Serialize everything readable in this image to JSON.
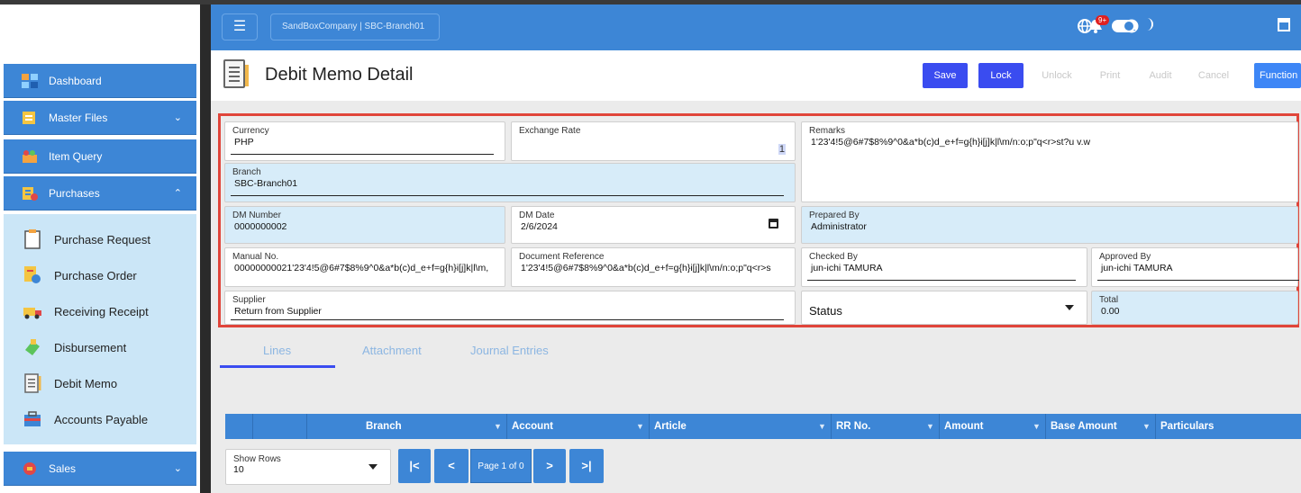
{
  "topbar": {
    "menu_icon": "menu-icon",
    "company": "SandBoxCompany | SBC-Branch01",
    "notification_badge": "9+"
  },
  "sidebar": {
    "items": [
      {
        "label": "Dashboard",
        "icon": "dashboard-icon"
      },
      {
        "label": "Master Files",
        "icon": "master-files-icon"
      },
      {
        "label": "Item Query",
        "icon": "item-query-icon"
      },
      {
        "label": "Purchases",
        "icon": "purchases-icon"
      },
      {
        "label": "Sales",
        "icon": "sales-icon"
      }
    ],
    "purchases_sub": [
      {
        "label": "Purchase Request",
        "icon": "purchase-request-icon"
      },
      {
        "label": "Purchase Order",
        "icon": "purchase-order-icon"
      },
      {
        "label": "Receiving Receipt",
        "icon": "receiving-receipt-icon"
      },
      {
        "label": "Disbursement",
        "icon": "disbursement-icon"
      },
      {
        "label": "Debit Memo",
        "icon": "debit-memo-icon"
      },
      {
        "label": "Accounts Payable",
        "icon": "accounts-payable-icon"
      }
    ]
  },
  "page": {
    "title": "Debit Memo Detail",
    "actions": {
      "save": "Save",
      "lock": "Lock",
      "unlock": "Unlock",
      "print": "Print",
      "audit": "Audit",
      "cancel": "Cancel",
      "function": "Function"
    }
  },
  "form": {
    "currency": {
      "label": "Currency",
      "value": "PHP"
    },
    "exchange_rate": {
      "label": "Exchange Rate",
      "value": "1"
    },
    "remarks": {
      "label": "Remarks",
      "value": "1'23'4!5@6#7$8%9^0&a*b(c)d_e+f=g{h}i[j]k|l\\m/n:o;p\"q<r>st?u v.w"
    },
    "branch": {
      "label": "Branch",
      "value": "SBC-Branch01"
    },
    "dm_number": {
      "label": "DM Number",
      "value": "0000000002"
    },
    "dm_date": {
      "label": "DM Date",
      "value": "2/6/2024"
    },
    "prepared_by": {
      "label": "Prepared By",
      "value": "Administrator"
    },
    "manual_no": {
      "label": "Manual No.",
      "value": "00000000021'23'4!5@6#7$8%9^0&a*b(c)d_e+f=g{h}i[j]k|l\\m,"
    },
    "document_reference": {
      "label": "Document Reference",
      "value": "1'23'4!5@6#7$8%9^0&a*b(c)d_e+f=g{h}i[j]k|l\\m/n:o;p\"q<r>s"
    },
    "checked_by": {
      "label": "Checked By",
      "value": "jun-ichi TAMURA"
    },
    "approved_by": {
      "label": "Approved By",
      "value": "jun-ichi TAMURA"
    },
    "supplier": {
      "label": "Supplier",
      "value": "Return from Supplier"
    },
    "status": {
      "value": "Status"
    },
    "total": {
      "label": "Total",
      "value": "0.00"
    }
  },
  "tabs": [
    "Lines",
    "Attachment",
    "Journal Entries"
  ],
  "grid": {
    "columns": [
      "Branch",
      "Account",
      "Article",
      "RR No.",
      "Amount",
      "Base Amount",
      "Particulars"
    ]
  },
  "pager": {
    "show_rows_label": "Show Rows",
    "show_rows_value": "10",
    "first": "|<",
    "prev": "<",
    "info": "Page 1 of 0",
    "next": ">",
    "last": ">|"
  }
}
